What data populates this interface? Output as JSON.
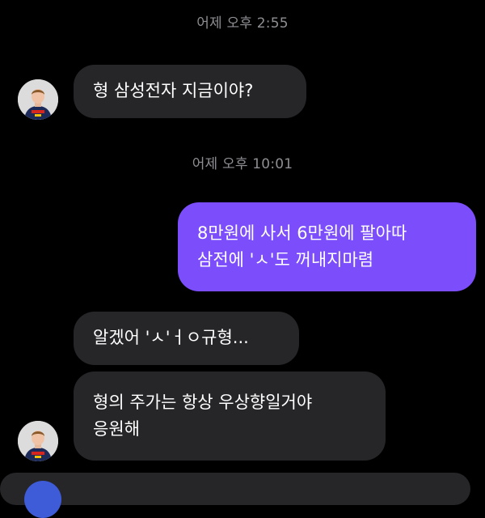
{
  "chat": {
    "timestamps": [
      "어제 오후 2:55",
      "어제 오후 10:01"
    ],
    "messages": [
      {
        "sender": "friend",
        "text": "형 삼성전자 지금이야?"
      },
      {
        "sender": "me",
        "text": "8만원에 사서 6만원에 팔아따\n삼전에 'ㅅ'도 꺼내지마렴"
      },
      {
        "sender": "friend",
        "text": "알겠어 'ㅅ'ㅓㅇ규형..."
      },
      {
        "sender": "friend",
        "text": "형의 주가는 항상 우상향일거야\n응원해"
      }
    ]
  },
  "colors": {
    "background": "#000000",
    "incoming_bubble": "#262629",
    "outgoing_bubble": "#7b4dfb",
    "timestamp_text": "#8e8e93"
  },
  "icons": {
    "friend_avatar": "racing-driver-avatar"
  }
}
